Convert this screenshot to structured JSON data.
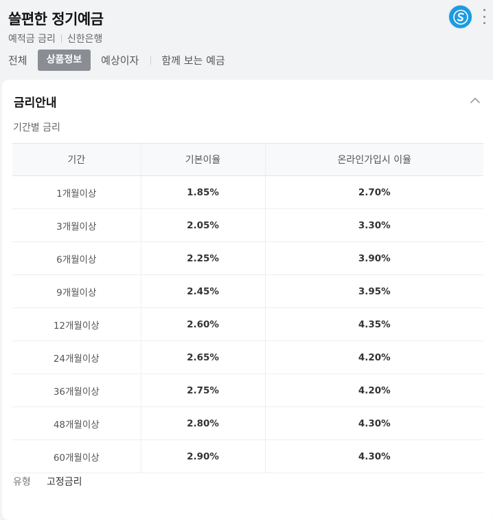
{
  "header": {
    "title": "쓸편한 정기예금",
    "subtitle": [
      "예적금 금리",
      "신한은행"
    ],
    "tabs": [
      {
        "label": "전체",
        "active": false
      },
      {
        "label": "상품정보",
        "active": true
      },
      {
        "label": "예상이자",
        "active": false
      },
      {
        "label": "함께 보는 예금",
        "active": false
      }
    ],
    "logo_icon": "bank-logo-icon",
    "menu_icon": "more-vertical-icon"
  },
  "card": {
    "title": "금리안내",
    "collapse_icon": "chevron-up-icon",
    "section_label": "기간별 금리",
    "columns": [
      "기간",
      "기본이율",
      "온라인가입시 이율"
    ],
    "rows": [
      {
        "period": "1개월이상",
        "base": "1.85%",
        "online": "2.70%"
      },
      {
        "period": "3개월이상",
        "base": "2.05%",
        "online": "3.30%"
      },
      {
        "period": "6개월이상",
        "base": "2.25%",
        "online": "3.90%"
      },
      {
        "period": "9개월이상",
        "base": "2.45%",
        "online": "3.95%"
      },
      {
        "period": "12개월이상",
        "base": "2.60%",
        "online": "4.35%"
      },
      {
        "period": "24개월이상",
        "base": "2.65%",
        "online": "4.20%"
      },
      {
        "period": "36개월이상",
        "base": "2.75%",
        "online": "4.20%"
      },
      {
        "period": "48개월이상",
        "base": "2.80%",
        "online": "4.30%"
      },
      {
        "period": "60개월이상",
        "base": "2.90%",
        "online": "4.30%"
      }
    ],
    "type_label": "유형",
    "type_value": "고정금리"
  },
  "colors": {
    "background": "#f2f3f5",
    "active_tab": "#8a8d93",
    "logo": "#1e9be0",
    "card": "#ffffff"
  }
}
